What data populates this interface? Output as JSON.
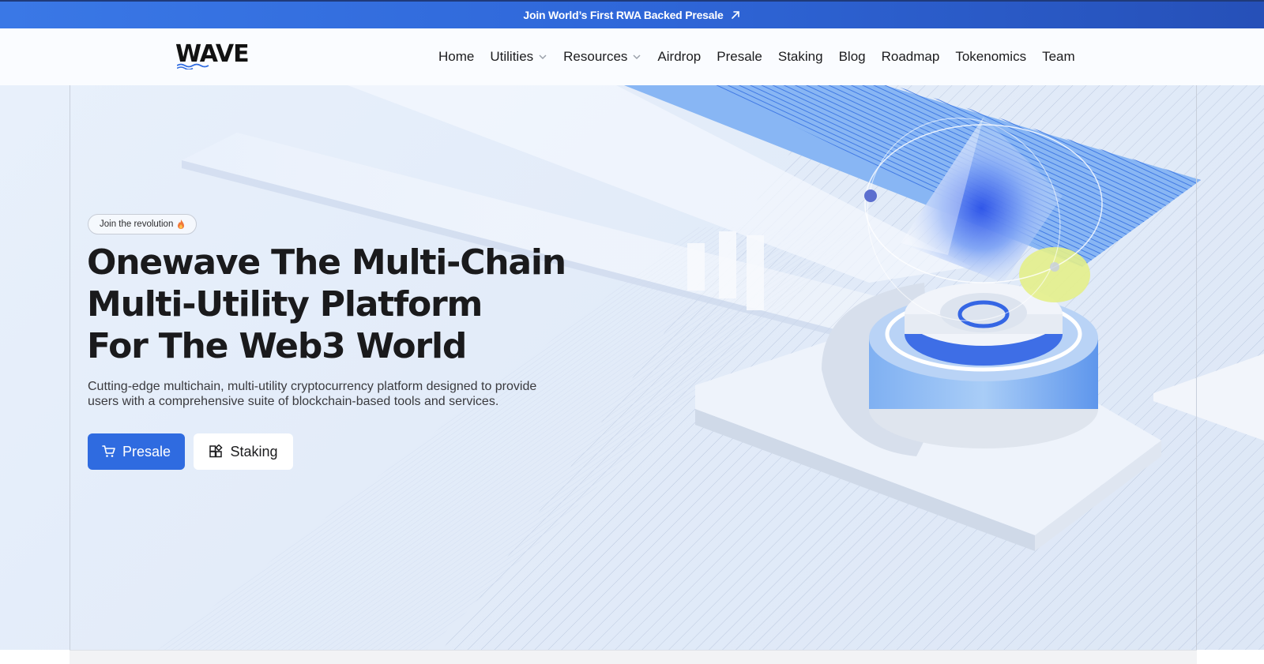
{
  "announcement": {
    "text": "Join World’s First RWA Backed Presale",
    "icon": "arrow-up-right-icon"
  },
  "header": {
    "logo_text": "WAVE",
    "nav": [
      {
        "label": "Home",
        "dropdown": false
      },
      {
        "label": "Utilities",
        "dropdown": true
      },
      {
        "label": "Resources",
        "dropdown": true
      },
      {
        "label": "Airdrop",
        "dropdown": false
      },
      {
        "label": "Presale",
        "dropdown": false
      },
      {
        "label": "Staking",
        "dropdown": false
      },
      {
        "label": "Blog",
        "dropdown": false
      },
      {
        "label": "Roadmap",
        "dropdown": false
      },
      {
        "label": "Tokenomics",
        "dropdown": false
      },
      {
        "label": "Team",
        "dropdown": false
      }
    ]
  },
  "hero": {
    "badge": "Join the revolution",
    "badge_icon": "flame-icon",
    "title_lines": [
      "Onewave The Multi-Chain",
      "Multi-Utility Platform",
      "For The Web3 World"
    ],
    "subtitle_lines": [
      "Cutting-edge multichain, multi-utility cryptocurrency platform designed to provide",
      "users with a comprehensive suite of blockchain-based tools and services."
    ],
    "primary_button": {
      "label": "Presale",
      "icon": "cart-icon"
    },
    "secondary_button": {
      "label": "Staking",
      "icon": "grid-icon"
    }
  },
  "colors": {
    "brand_blue": "#2f6be0",
    "announcement_bg": "#3a78e6",
    "title_text": "#1a1a1c"
  }
}
